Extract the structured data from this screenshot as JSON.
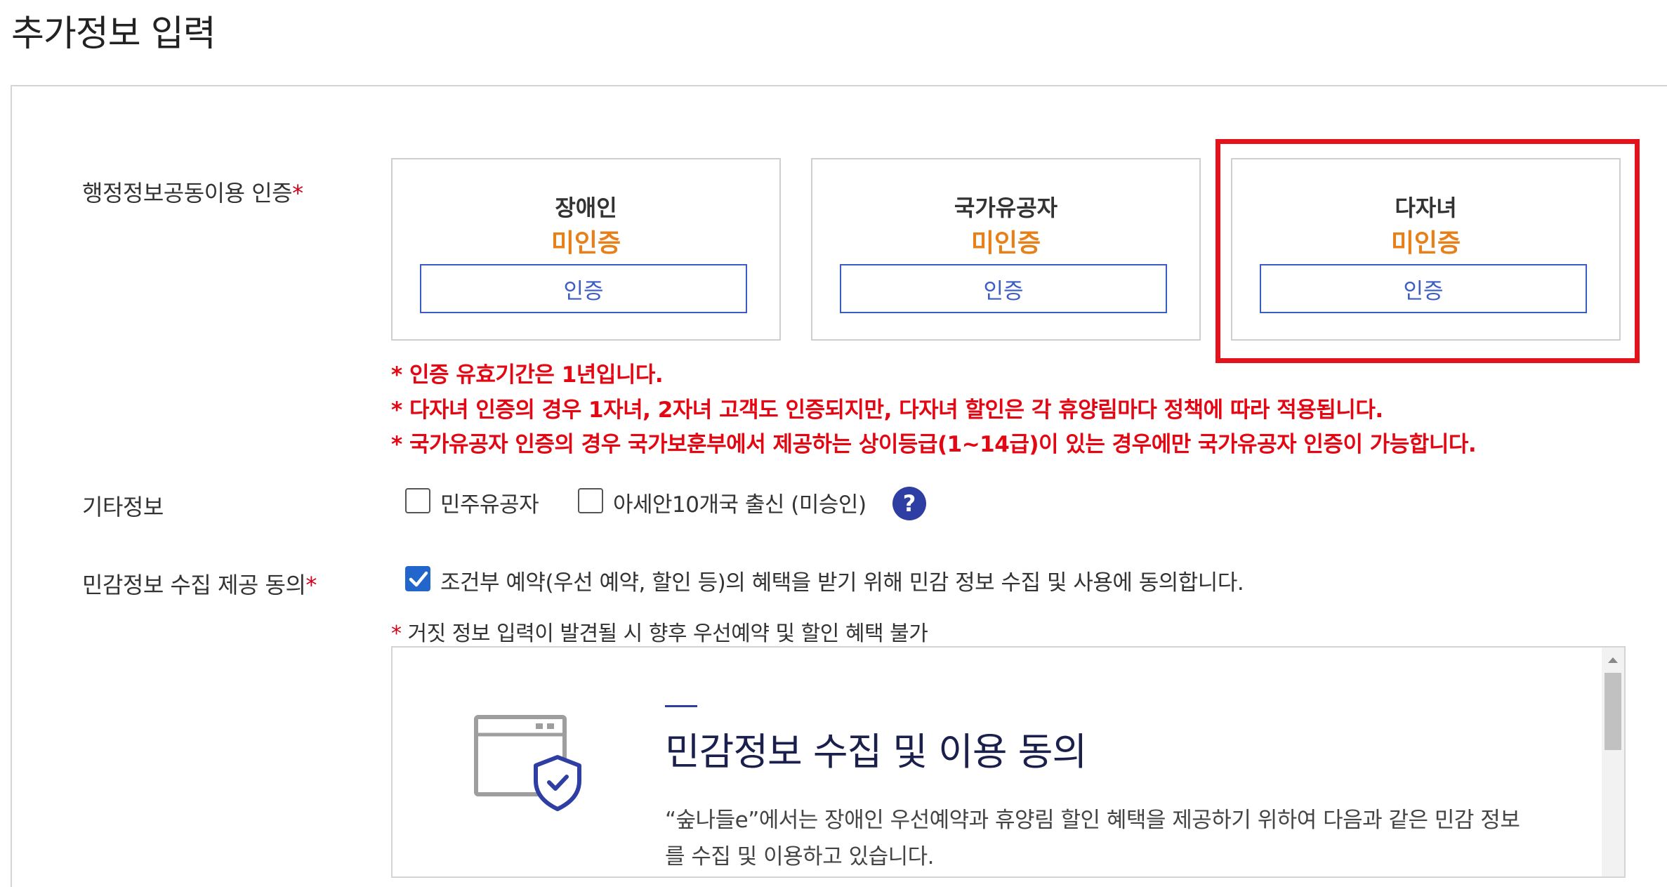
{
  "page": {
    "title": "추가정보 입력"
  },
  "admin_info": {
    "label": "행정정보공동이용 인증",
    "required_mark": "*",
    "cards": [
      {
        "title": "장애인",
        "status": "미인증",
        "button": "인증"
      },
      {
        "title": "국가유공자",
        "status": "미인증",
        "button": "인증"
      },
      {
        "title": "다자녀",
        "status": "미인증",
        "button": "인증"
      }
    ],
    "notes": [
      "* 인증 유효기간은 1년입니다.",
      "* 다자녀 인증의 경우 1자녀, 2자녀 고객도 인증되지만, 다자녀 할인은 각 휴양림마다 정책에 따라 적용됩니다.",
      "* 국가유공자 인증의 경우 국가보훈부에서 제공하는 상이등급(1~14급)이 있는 경우에만 국가유공자 인증이 가능합니다."
    ]
  },
  "other_info": {
    "label": "기타정보",
    "options": [
      {
        "label": "민주유공자",
        "checked": false
      },
      {
        "label": "아세안10개국 출신 (미승인)",
        "checked": false
      }
    ],
    "help": "?"
  },
  "sensitive": {
    "label": "민감정보 수집 제공 동의",
    "required_mark": "*",
    "consent_label": "조건부 예약(우선 예약, 할인 등)의 혜택을 받기 위해 민감 정보 수집 및 사용에 동의합니다.",
    "consent_checked": true,
    "warning_mark": "*",
    "warning_text": " 거짓 정보 입력이 발견될 시 향후 우선예약 및 할인 혜택 불가",
    "box_title": "민감정보 수집 및 이용 동의",
    "box_body": "“숲나들e”에서는 장애인 우선예약과 휴양림 할인 혜택을 제공하기 위하여 다음과 같은 민감 정보를 수집 및 이용하고 있습니다."
  },
  "colors": {
    "accent": "#3b5cc4",
    "status": "#e8801a",
    "required": "#e30613",
    "highlight": "#e3121b",
    "help": "#2f3ea3"
  }
}
